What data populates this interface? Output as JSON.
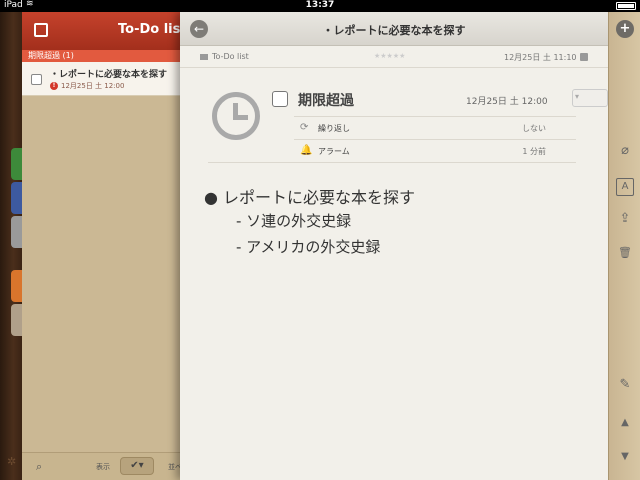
{
  "statusbar": {
    "carrier": "iPad",
    "time": "13:37"
  },
  "list": {
    "title": "To-Do list",
    "section": "期限超過 (1)",
    "items": [
      {
        "title": "・レポートに必要な本を探す",
        "due": "12月25日 土 12:00"
      }
    ],
    "footer": {
      "show_label": "表示",
      "sort_label": "並べ"
    }
  },
  "detail": {
    "title": "・レポートに必要な本を探す",
    "list_name": "To-Do list",
    "modified": "12月25日 土 11:10",
    "stars": "★★★★★",
    "task_status": "期限超過",
    "due": "12月25日 土 12:00",
    "repeat_label": "繰り返し",
    "repeat_value": "しない",
    "alarm_label": "アラーム",
    "alarm_value": "1 分前",
    "note": {
      "bullet": "● レポートに必要な本を探す",
      "sub": [
        "- ソ連の外交史録",
        "- アメリカの外交史録"
      ]
    }
  },
  "toolbar": {
    "add_glyph": "+",
    "attach_glyph": "⌀",
    "text_glyph": "A",
    "share_glyph": "⇪",
    "trash_glyph": "🗑",
    "edit_glyph": "✎",
    "up_glyph": "▲",
    "down_glyph": "▼"
  }
}
